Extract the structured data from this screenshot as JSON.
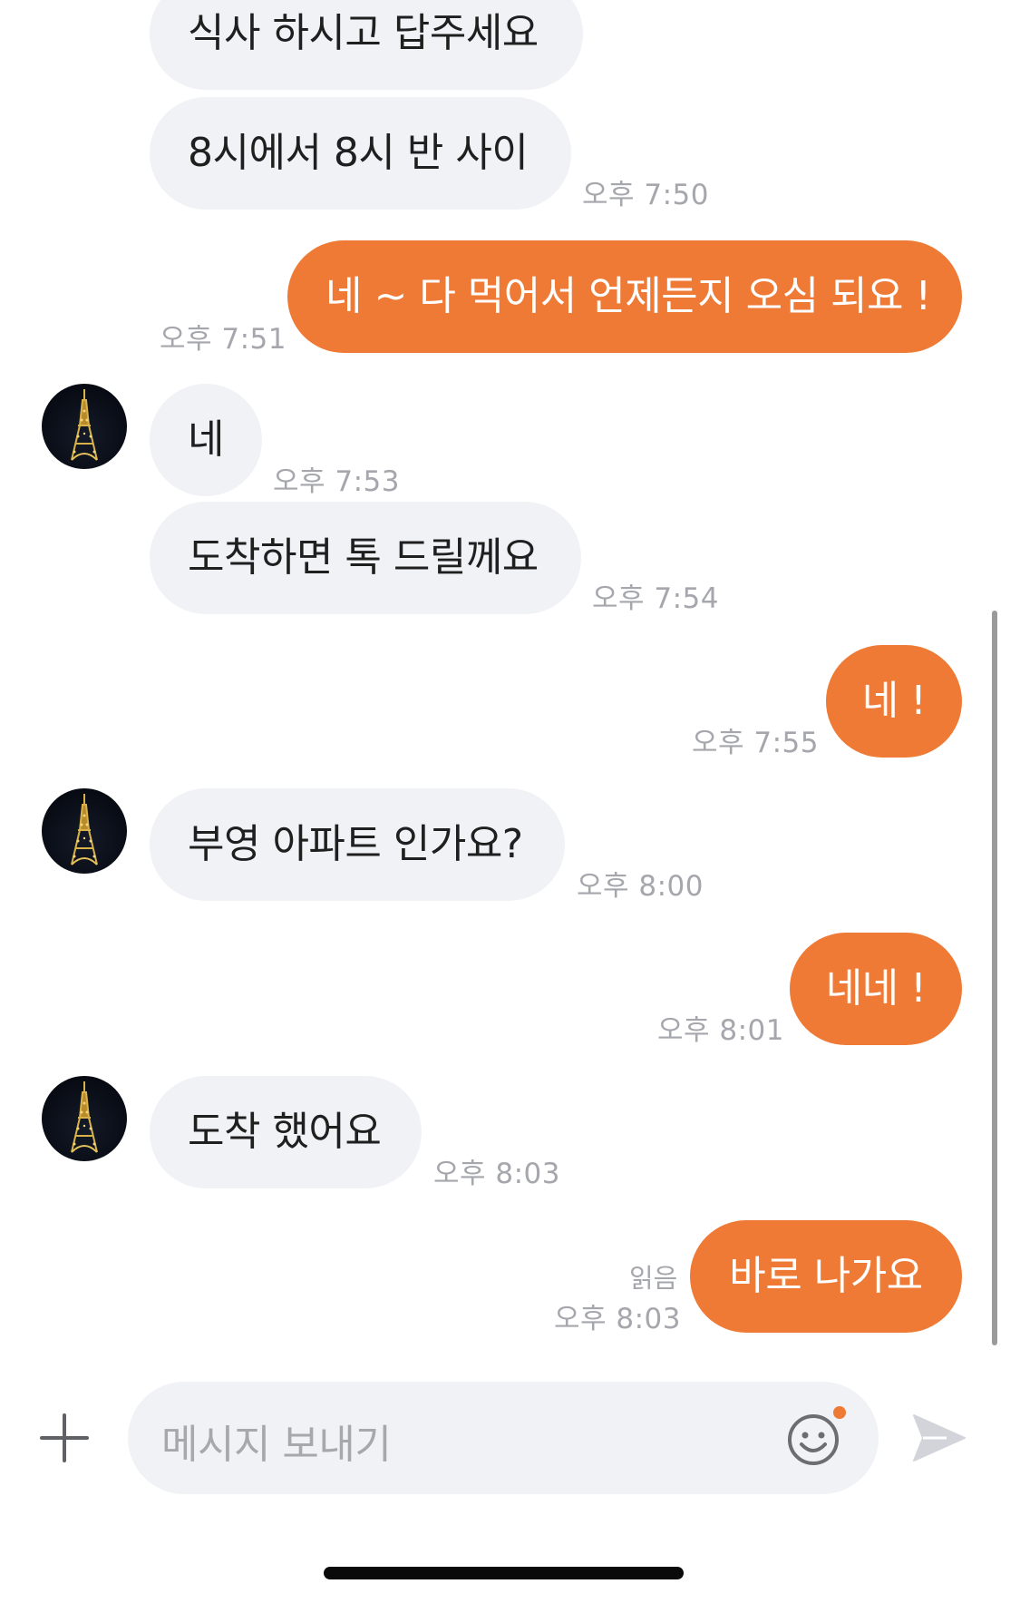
{
  "messages": [
    {
      "id": "m1",
      "direction": "incoming",
      "text": "식사 하시고 답주세요",
      "time": ""
    },
    {
      "id": "m2",
      "direction": "incoming",
      "text": "8시에서 8시 반 사이",
      "time": "오후 7:50"
    },
    {
      "id": "m3",
      "direction": "outgoing",
      "text": "네 ~ 다 먹어서 언제든지 오심 되요 !",
      "time": "오후 7:51"
    },
    {
      "id": "m4",
      "direction": "incoming",
      "text": "네",
      "time": "오후 7:53"
    },
    {
      "id": "m5",
      "direction": "incoming",
      "text": "도착하면 톡 드릴께요",
      "time": "오후 7:54"
    },
    {
      "id": "m6",
      "direction": "outgoing",
      "text": "네 !",
      "time": "오후 7:55"
    },
    {
      "id": "m7",
      "direction": "incoming",
      "text": "부영 아파트 인가요?",
      "time": "오후 8:00"
    },
    {
      "id": "m8",
      "direction": "outgoing",
      "text": "네네 !",
      "time": "오후 8:01"
    },
    {
      "id": "m9",
      "direction": "incoming",
      "text": "도착 했어요",
      "time": "오후 8:03"
    },
    {
      "id": "m10",
      "direction": "outgoing",
      "text": "바로 나가요",
      "time": "오후 8:03",
      "status": "읽음"
    }
  ],
  "composer": {
    "placeholder": "메시지 보내기"
  },
  "icons": {
    "add": "plus-icon",
    "emoji": "emoji-icon",
    "send": "send-icon",
    "avatar": "eiffel-tower-avatar"
  },
  "colors": {
    "outgoing_bubble": "#ee7a36",
    "incoming_bubble": "#f1f2f5",
    "timestamp": "#a5a7ad",
    "notification_dot": "#ee7a36"
  }
}
